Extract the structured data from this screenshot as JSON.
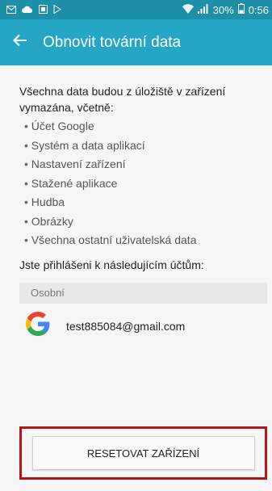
{
  "status_bar": {
    "battery_text": "30%",
    "time": "0:56"
  },
  "app_bar": {
    "title": "Obnovit tovární data"
  },
  "content": {
    "intro": "Všechna data budou z úložiště v zařízení vymazána, včetně:",
    "items": [
      "Účet Google",
      "Systém a data aplikací",
      "Nastavení zařízení",
      "Stažené aplikace",
      "Hudba",
      "Obrázky",
      "Všechna ostatní uživatelská data"
    ],
    "accounts_label": "Jste přihlášeni k následujícím účtům:",
    "section_header": "Osobní",
    "account_email": "test885084@gmail.com",
    "reset_button": "RESETOVAT ZAŘÍZENÍ"
  },
  "colors": {
    "status_bar": "#1d8fa6",
    "app_bar": "#25a6c4",
    "highlight_border": "#b3141e"
  }
}
